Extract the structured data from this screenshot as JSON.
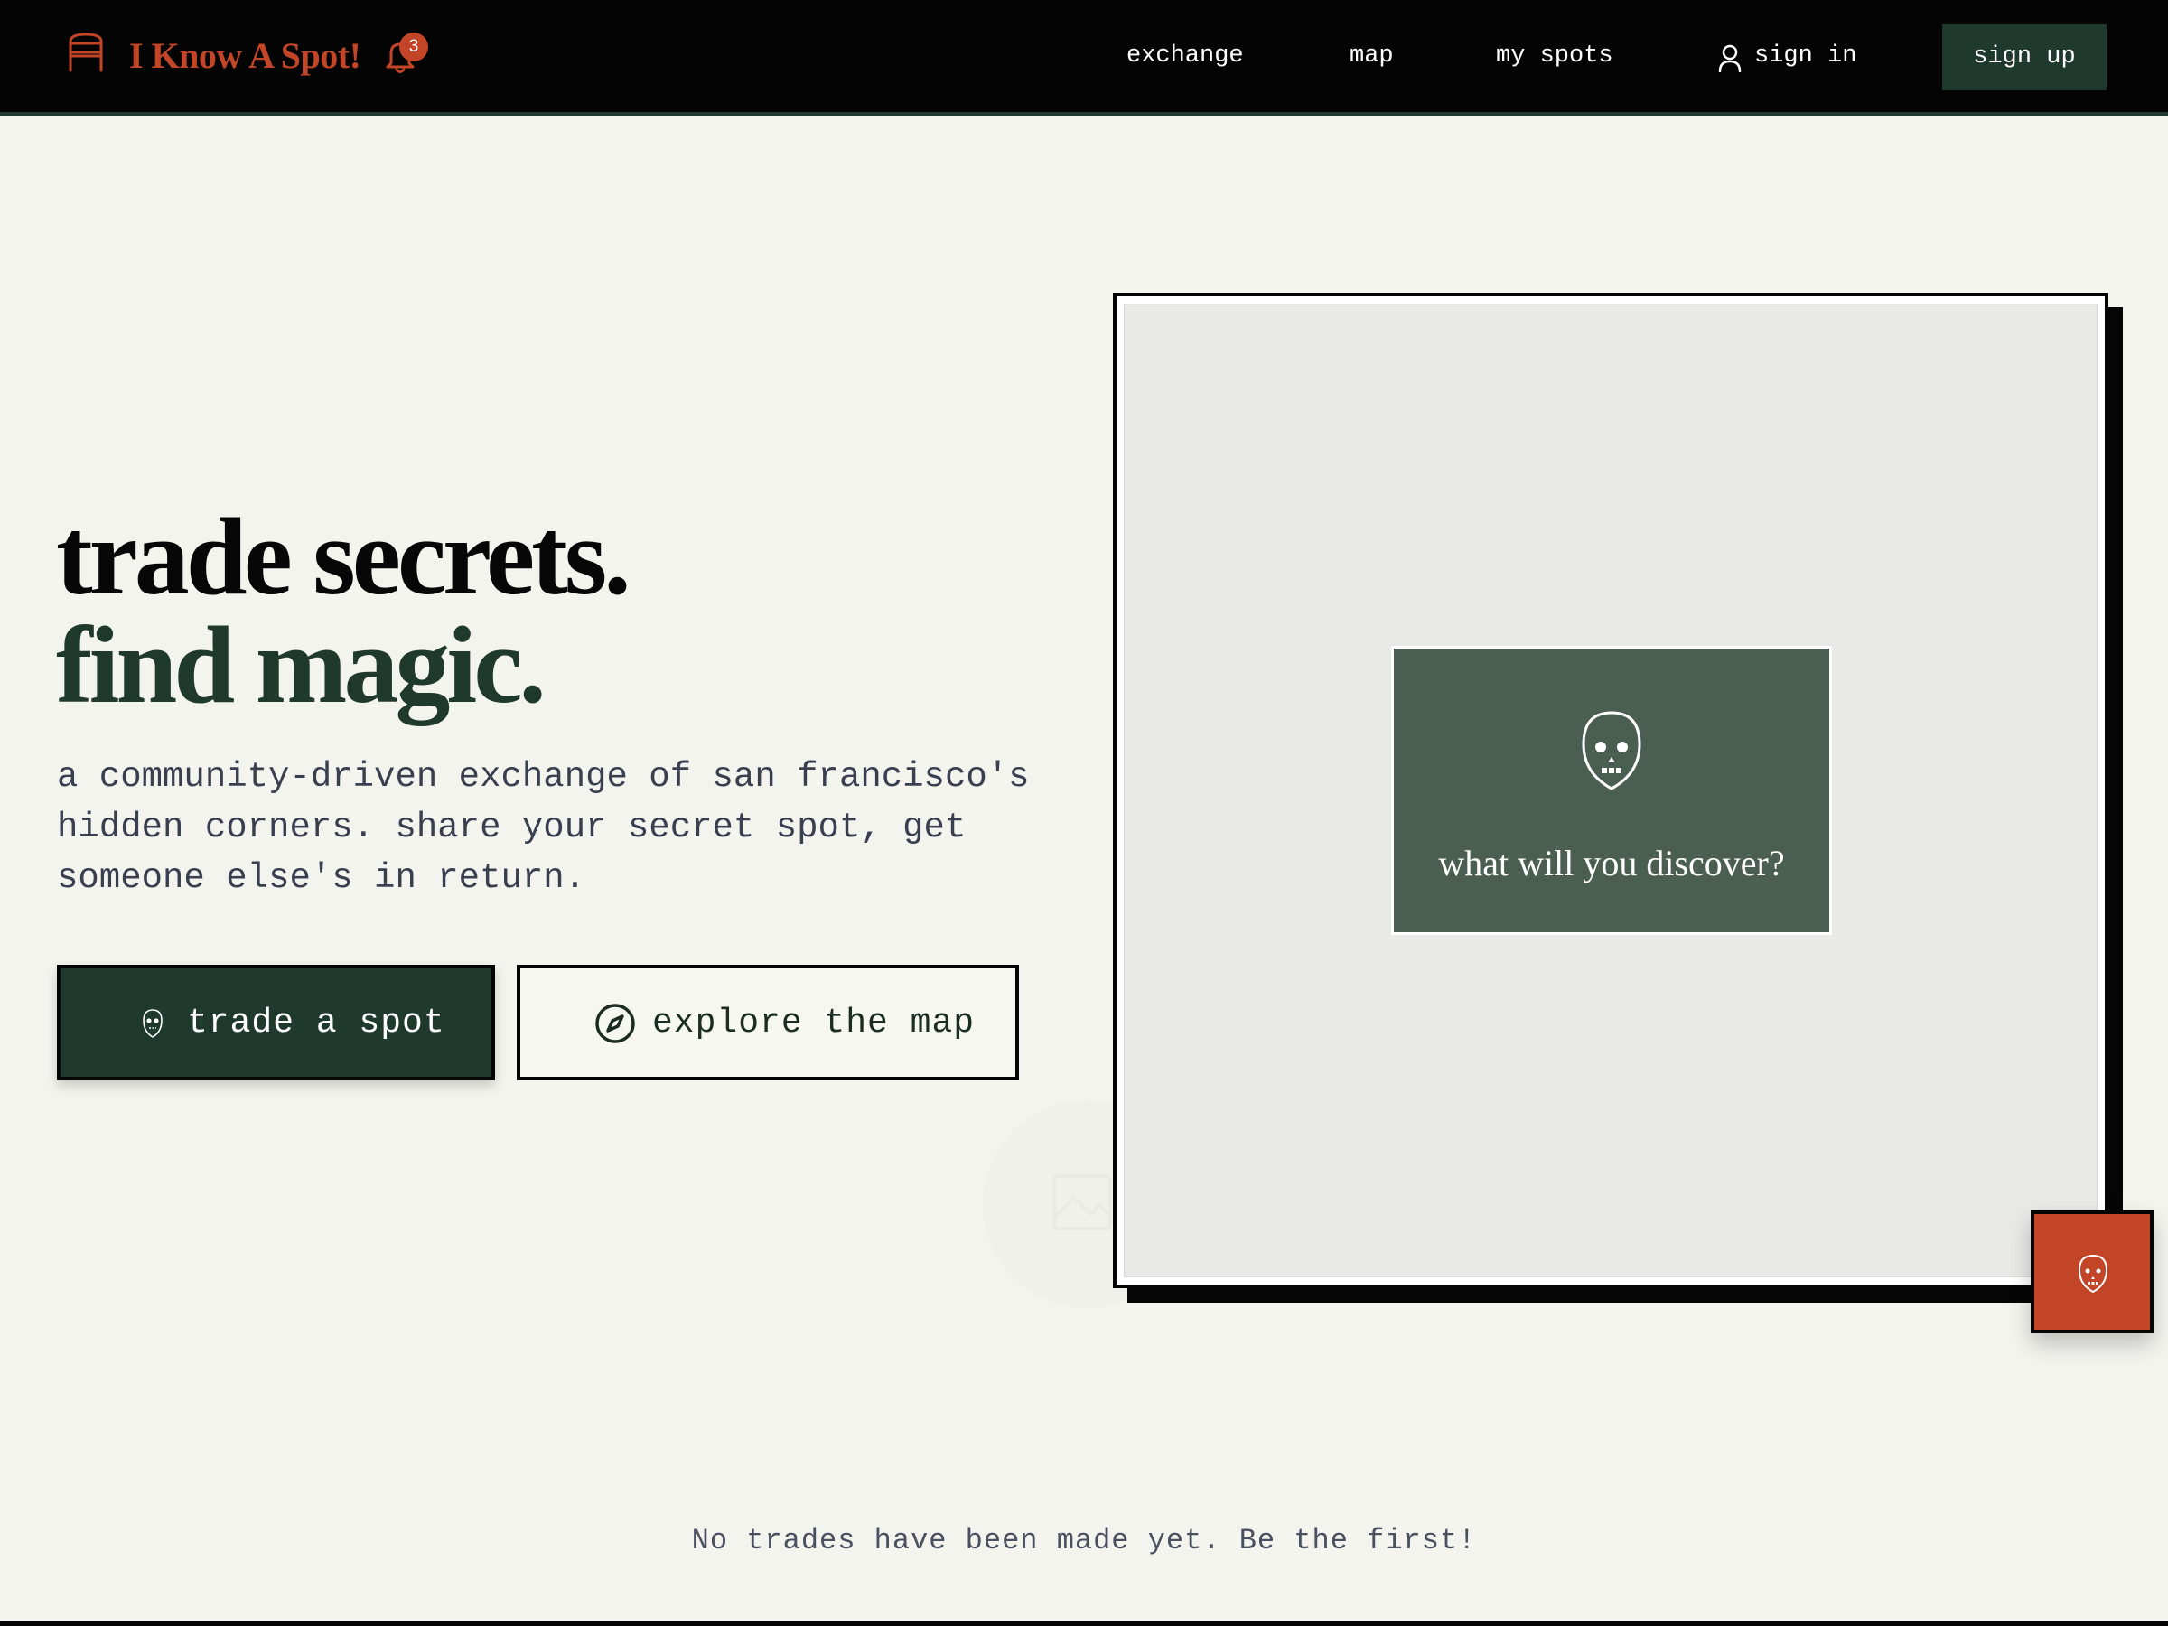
{
  "header": {
    "brand": "I Know A Spot!",
    "notification_count": "3",
    "nav": {
      "exchange": "exchange",
      "map": "map",
      "my_spots": "my spots",
      "sign_in": "sign in",
      "sign_up": "sign up"
    }
  },
  "hero": {
    "headline_line1": "trade secrets.",
    "headline_line2": "find magic.",
    "subtext": "a community-driven exchange of san francisco's hidden corners. share your secret spot, get someone else's in return.",
    "trade_button": "trade a spot",
    "explore_button": "explore the map"
  },
  "preview": {
    "card_text": "what will you discover?"
  },
  "footer": {
    "status": "No trades have been made yet. Be the first!"
  },
  "colors": {
    "brand_orange": "#c24527",
    "forest_green": "#1f3a2c",
    "card_green": "#4a5e51",
    "page_bg": "#f4f4ef",
    "ink": "#050505"
  },
  "icons": [
    "bench-logo-icon",
    "bell-icon",
    "user-icon",
    "mask-icon",
    "compass-icon",
    "image-icon"
  ]
}
